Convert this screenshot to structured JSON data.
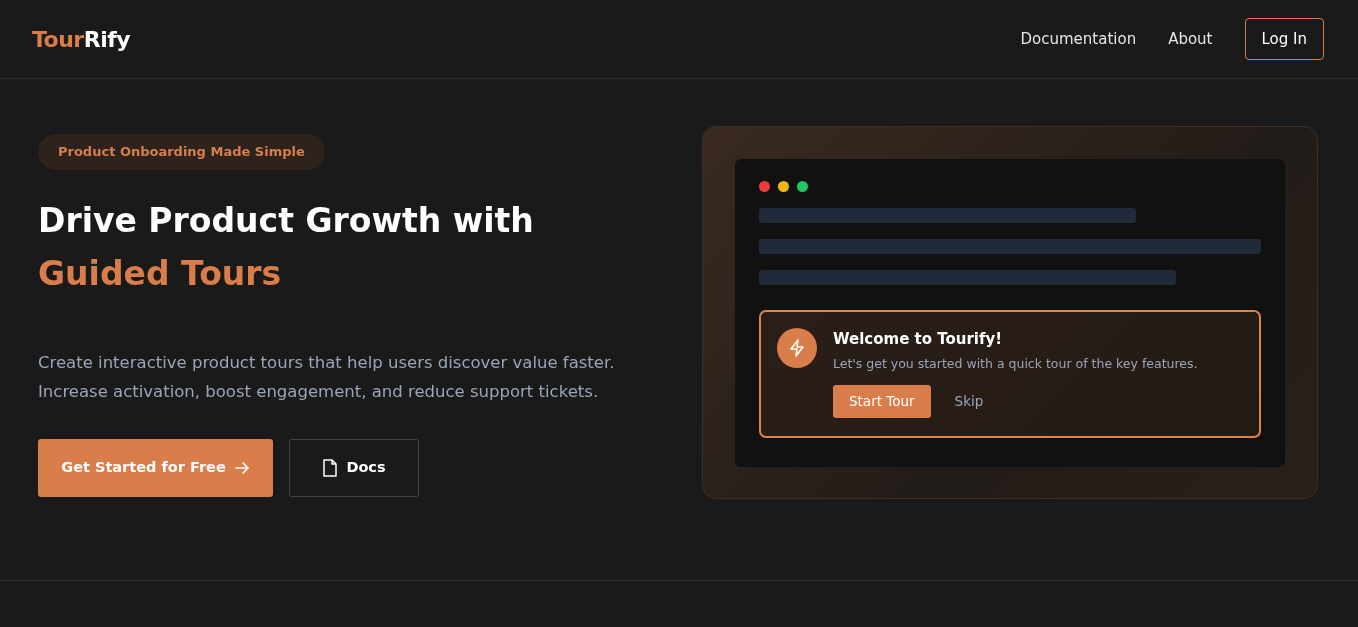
{
  "brand": {
    "first": "Tour",
    "second": "Rify"
  },
  "nav": {
    "links": [
      "Documentation",
      "About"
    ],
    "login": "Log In"
  },
  "hero": {
    "badge": "Product Onboarding Made Simple",
    "title_line_1": "Drive Product Growth with",
    "title_line_2": "Guided Tours",
    "description": "Create interactive product tours that help users discover value faster. Increase activation, boost engagement, and reduce support tickets.",
    "primary_button": "Get Started for Free",
    "secondary_button": "Docs"
  },
  "preview": {
    "window_dots": [
      {
        "color": "#ef3b3b"
      },
      {
        "color": "#f2b80f"
      },
      {
        "color": "#22c55e"
      }
    ],
    "tooltip": {
      "title": "Welcome to Tourify!",
      "text": "Let's get you started with a quick tour of the key features.",
      "start": "Start Tour",
      "skip": "Skip"
    }
  }
}
